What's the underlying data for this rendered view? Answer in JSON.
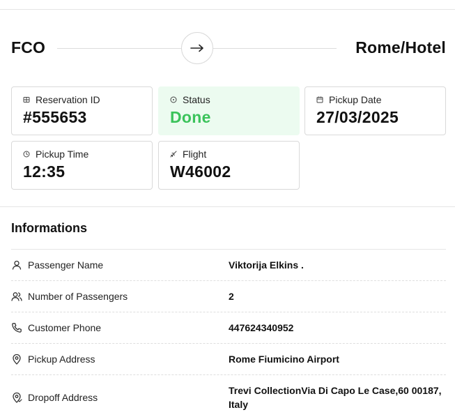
{
  "route": {
    "origin": "FCO",
    "destination": "Rome/Hotel",
    "arrow_icon": "arrow-right-icon"
  },
  "cards": {
    "reservation": {
      "label": "Reservation ID",
      "value": "#555653",
      "icon": "grid-icon"
    },
    "status": {
      "label": "Status",
      "value": "Done",
      "icon": "clock-circle-icon",
      "color": "#3bc35b",
      "background": "#ecfbf0"
    },
    "pickup_date": {
      "label": "Pickup Date",
      "value": "27/03/2025",
      "icon": "calendar-icon"
    },
    "pickup_time": {
      "label": "Pickup Time",
      "value": "12:35",
      "icon": "clock-icon"
    },
    "flight": {
      "label": "Flight",
      "value": "W46002",
      "icon": "plane-icon"
    }
  },
  "informations": {
    "title": "Informations",
    "rows": [
      {
        "label": "Passenger Name",
        "value": "Viktorija Elkins .",
        "icon": "user-icon"
      },
      {
        "label": "Number of Passengers",
        "value": "2",
        "icon": "users-icon"
      },
      {
        "label": "Customer Phone",
        "value": "447624340952",
        "icon": "phone-icon"
      },
      {
        "label": "Pickup Address",
        "value": "Rome Fiumicino Airport",
        "icon": "map-pin-icon"
      },
      {
        "label": "Dropoff Address",
        "value": "Trevi CollectionVia Di Capo Le Case,60 00187, Italy",
        "icon": "map-pin-check-icon"
      }
    ]
  }
}
